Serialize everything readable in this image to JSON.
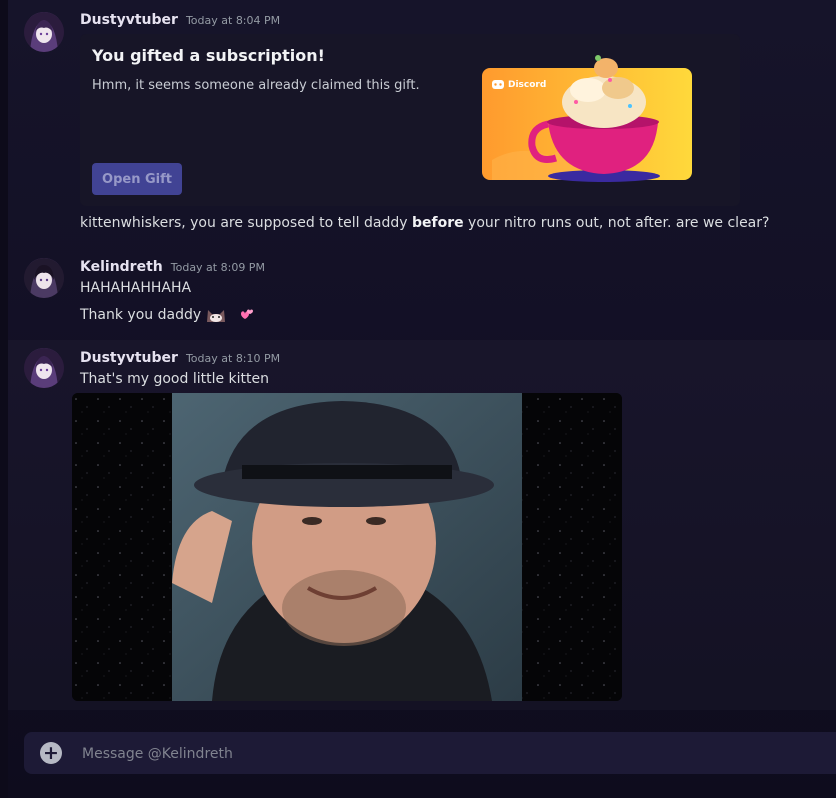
{
  "messages": [
    {
      "author": "Dustyvtuber",
      "timestamp": "Today at 8:04 PM",
      "gift": {
        "title": "You gifted a subscription!",
        "subtitle": "Hmm, it seems someone already claimed this gift.",
        "button_label": "Open Gift",
        "card_brand": "Discord"
      },
      "text_parts": [
        "kittenwhiskers, you are supposed to tell daddy ",
        "before",
        " your nitro runs out, not after. are we clear?"
      ]
    },
    {
      "author": "Kelindreth",
      "timestamp": "Today at 8:09 PM",
      "lines": [
        "HAHAHAHHAHA",
        "Thank you daddy"
      ],
      "emojis": [
        "cat-emoji",
        "two-hearts-emoji"
      ]
    },
    {
      "author": "Dustyvtuber",
      "timestamp": "Today at 8:10 PM",
      "lines": [
        "That's my good little kitten"
      ],
      "attachment": "image-attachment"
    }
  ],
  "composer": {
    "placeholder": "Message @Kelindreth"
  },
  "colors": {
    "background": "#14122a",
    "gift_card": "#171527",
    "button": "#414394",
    "composer": "#1d1a36",
    "username": "#e6e2f0",
    "timestamp": "#949ba4"
  },
  "icons": [
    "add-attachment-icon",
    "discord-logo-icon"
  ]
}
